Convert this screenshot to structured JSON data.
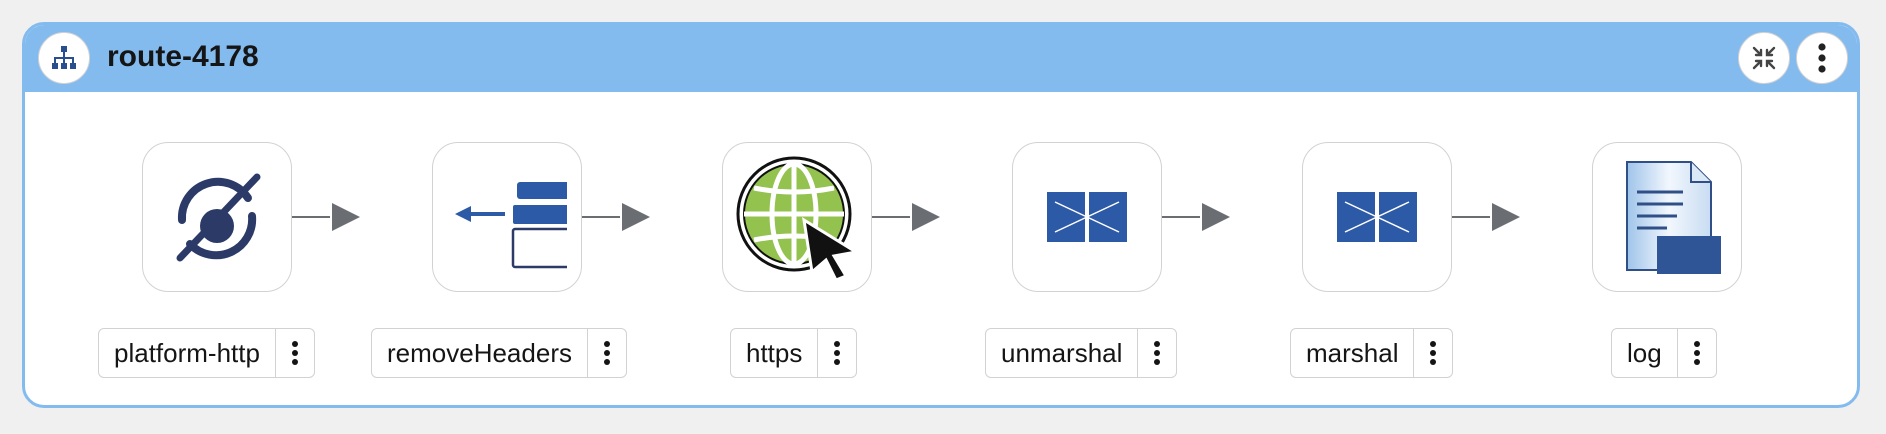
{
  "route": {
    "title": "route-4178",
    "icon": "route-tree-icon",
    "header_buttons": [
      "collapse-icon",
      "kebab-menu-icon"
    ],
    "header_color": "#84bbef"
  },
  "nodes": [
    {
      "label": "platform-http",
      "icon": "platform-http-icon"
    },
    {
      "label": "removeHeaders",
      "icon": "remove-headers-icon"
    },
    {
      "label": "https",
      "icon": "globe-cursor-icon"
    },
    {
      "label": "unmarshal",
      "icon": "unmarshal-icon"
    },
    {
      "label": "marshal",
      "icon": "marshal-icon"
    },
    {
      "label": "log",
      "icon": "log-icon"
    }
  ]
}
